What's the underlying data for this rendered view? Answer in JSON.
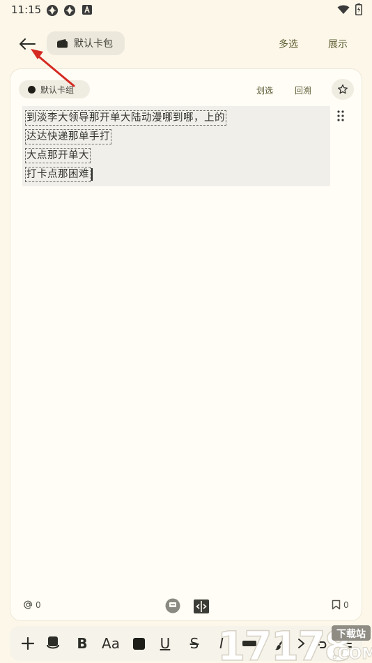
{
  "status_bar": {
    "time": "11:15"
  },
  "header": {
    "wallet_label": "默认卡包",
    "multi_select_label": "多选",
    "display_label": "展示"
  },
  "card": {
    "group_label": "默认卡组",
    "swipe_label": "划选",
    "backtrack_label": "回溯",
    "lines": [
      "到淡李大领导那开单大陆动漫哪到哪，上的",
      "达达快递那单手打",
      "大点那开单大",
      "打卡点那困难"
    ],
    "mention_count": "0",
    "bookmark_count": "0"
  },
  "toolbar": {
    "bold_label": "B",
    "font_size_label": "Aa",
    "underline_label": "U",
    "strike_label": "S",
    "italic_label": "I"
  },
  "watermark": {
    "number": "17178",
    "site": "下载站",
    "domain": ".COM"
  },
  "colors": {
    "background": "#fcf7e9",
    "card": "#fffdf5",
    "accent_text": "#5c5c30",
    "annotation_arrow": "#d42a22"
  }
}
